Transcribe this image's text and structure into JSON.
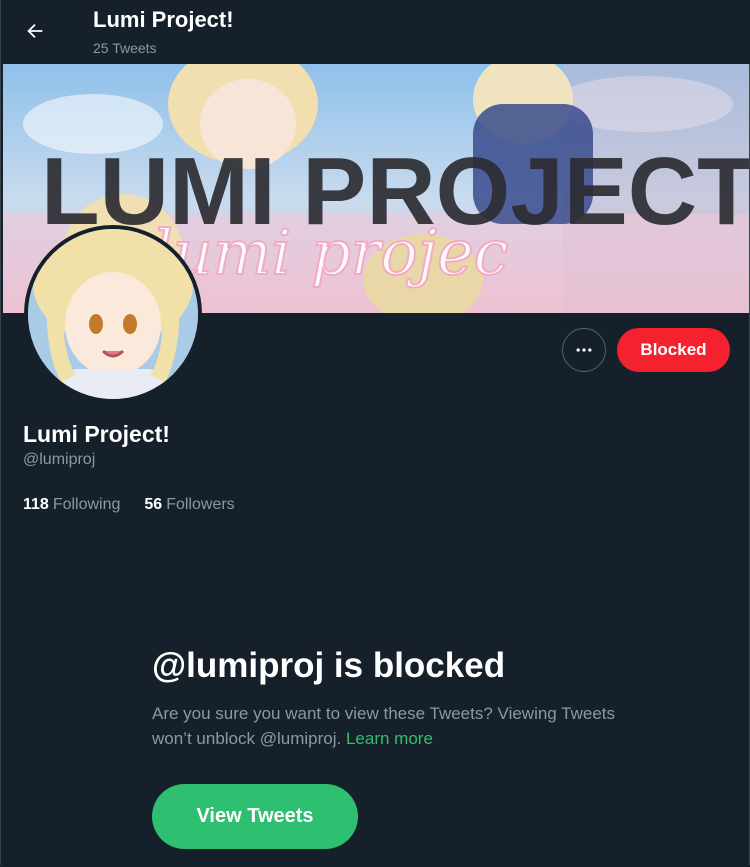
{
  "header": {
    "title": "Lumi Project!",
    "tweet_count": "25 Tweets"
  },
  "banner": {
    "headline": "LUMI PROJECT!",
    "script": "lumi projec"
  },
  "actions": {
    "blocked_label": "Blocked"
  },
  "profile": {
    "display_name": "Lumi Project!",
    "handle": "@lumiproj",
    "following_count": "118",
    "following_label": "Following",
    "followers_count": "56",
    "followers_label": "Followers"
  },
  "blocked_notice": {
    "title": "@lumiproj is blocked",
    "description": "Are you sure you want to view these Tweets? Viewing Tweets won’t unblock @lumiproj.",
    "learn_more": "Learn more",
    "view_button": "View Tweets"
  },
  "colors": {
    "background": "#15202b",
    "blocked_red": "#f4212e",
    "accent_green": "#2fbf71",
    "secondary_text": "#8b98a5"
  },
  "icons": {
    "back": "arrow-left-icon",
    "more": "more-horizontal-icon"
  }
}
